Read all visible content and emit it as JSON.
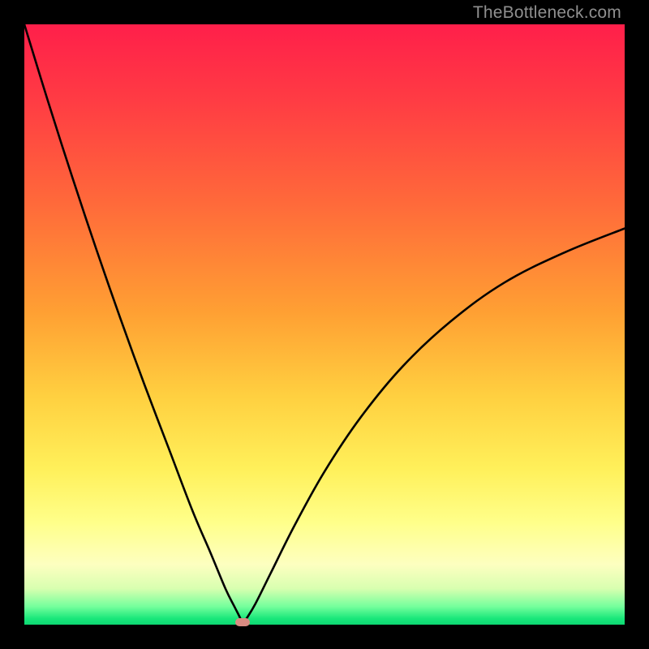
{
  "watermark": "TheBottleneck.com",
  "chart_data": {
    "type": "line",
    "title": "",
    "xlabel": "",
    "ylabel": "",
    "xlim": [
      0,
      1
    ],
    "ylim": [
      0,
      1
    ],
    "grid": false,
    "legend": false,
    "annotations": [
      {
        "kind": "marker",
        "shape": "rounded-rect",
        "x": 0.363,
        "y": 0.0,
        "color": "#d98b82"
      }
    ],
    "series": [
      {
        "name": "curve",
        "color": "#000000",
        "x": [
          0.0,
          0.04,
          0.08,
          0.12,
          0.16,
          0.2,
          0.24,
          0.28,
          0.31,
          0.335,
          0.35,
          0.36,
          0.363,
          0.37,
          0.385,
          0.41,
          0.45,
          0.5,
          0.56,
          0.63,
          0.71,
          0.8,
          0.9,
          1.0
        ],
        "y": [
          1.0,
          0.87,
          0.745,
          0.625,
          0.51,
          0.4,
          0.295,
          0.19,
          0.12,
          0.06,
          0.03,
          0.01,
          0.0,
          0.01,
          0.035,
          0.085,
          0.165,
          0.255,
          0.345,
          0.43,
          0.505,
          0.57,
          0.62,
          0.66
        ]
      }
    ],
    "background_gradient": {
      "direction": "vertical",
      "stops": [
        {
          "pos": 0.0,
          "color": "#ff1f4a"
        },
        {
          "pos": 0.3,
          "color": "#ff6a3a"
        },
        {
          "pos": 0.62,
          "color": "#ffd040"
        },
        {
          "pos": 0.83,
          "color": "#ffff8a"
        },
        {
          "pos": 0.94,
          "color": "#d8ffb0"
        },
        {
          "pos": 1.0,
          "color": "#0ed873"
        }
      ]
    }
  }
}
